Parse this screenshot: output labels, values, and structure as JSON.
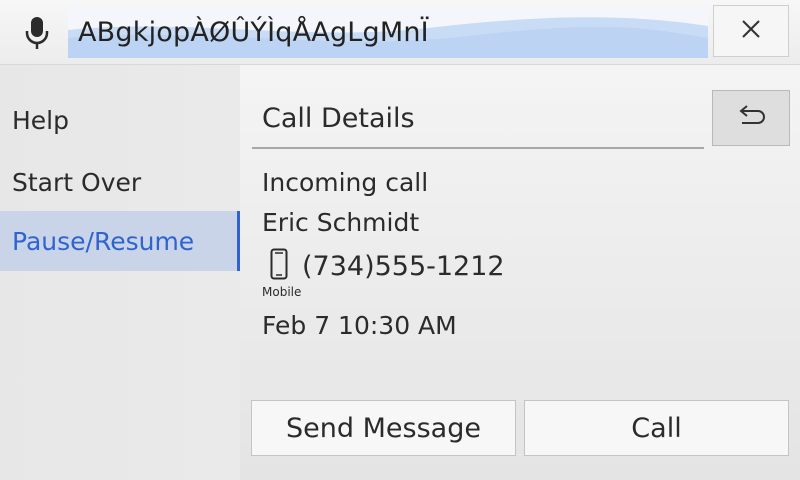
{
  "topbar": {
    "mic_icon": "microphone-icon",
    "speech_text": "ABgkjopÀØÛÝÌqÅAgLgMnÏ",
    "close_icon": "close-icon"
  },
  "sidebar": {
    "items": [
      {
        "label": "Help"
      },
      {
        "label": "Start Over"
      },
      {
        "label": "Pause/Resume",
        "active": true
      }
    ]
  },
  "main": {
    "title": "Call Details",
    "back_icon": "back-arrow-icon",
    "status": "Incoming call",
    "caller_name": "Eric Schmidt",
    "phone_icon": "mobile-phone-icon",
    "phone_number": "(734)555-1212",
    "phone_type": "Mobile",
    "datetime": "Feb 7 10:30 AM",
    "actions": {
      "send_message": "Send Message",
      "call": "Call"
    }
  },
  "colors": {
    "accent": "#2f64d0",
    "active_bg": "#c9d4e8"
  }
}
